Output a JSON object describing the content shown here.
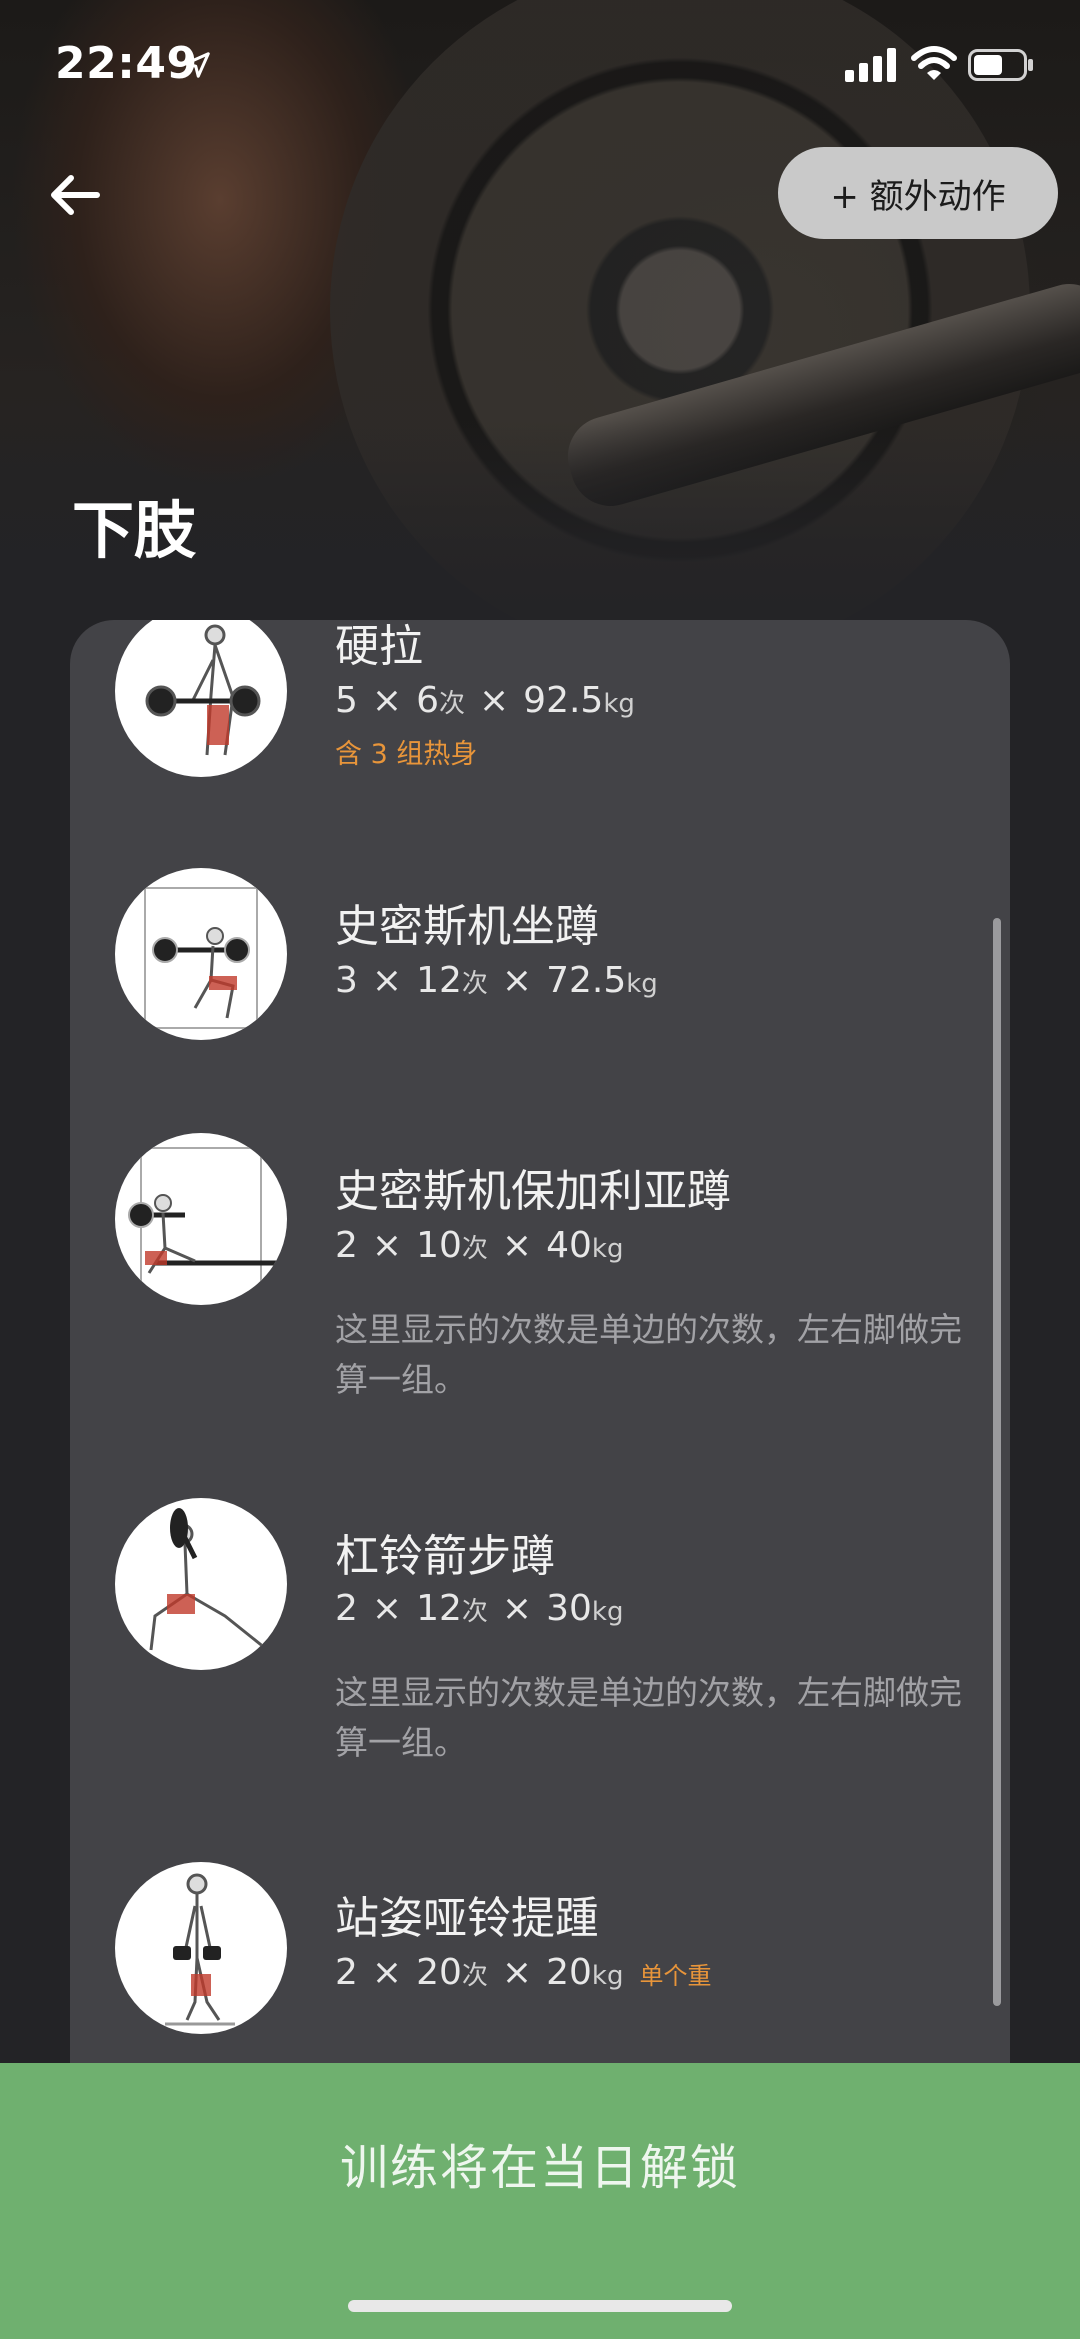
{
  "status_bar": {
    "time": "22:49"
  },
  "header": {
    "extra_button": "+ 额外动作",
    "title": "下肢"
  },
  "exercises": [
    {
      "name": "硬拉",
      "sets": "5",
      "reps": "6",
      "reps_unit": "次",
      "weight": "92.5",
      "weight_unit": "kg",
      "tag": "含 3 组热身"
    },
    {
      "name": "史密斯机坐蹲",
      "sets": "3",
      "reps": "12",
      "reps_unit": "次",
      "weight": "72.5",
      "weight_unit": "kg"
    },
    {
      "name": "史密斯机保加利亚蹲",
      "sets": "2",
      "reps": "10",
      "reps_unit": "次",
      "weight": "40",
      "weight_unit": "kg",
      "note": "这里显示的次数是单边的次数，左右脚做完算一组。"
    },
    {
      "name": "杠铃箭步蹲",
      "sets": "2",
      "reps": "12",
      "reps_unit": "次",
      "weight": "30",
      "weight_unit": "kg",
      "note": "这里显示的次数是单边的次数，左右脚做完算一组。"
    },
    {
      "name": "站姿哑铃提踵",
      "sets": "2",
      "reps": "20",
      "reps_unit": "次",
      "weight": "20",
      "weight_unit": "kg",
      "tag": "单个重"
    }
  ],
  "times_symbol": "×",
  "bottom": {
    "unlock_label": "训练将在当日解锁"
  },
  "colors": {
    "accent_green": "#6fb06f",
    "tag_orange": "#e8953a",
    "card_bg": "#434347"
  },
  "icons": [
    "location-arrow-icon",
    "cellular-signal-icon",
    "wifi-icon",
    "battery-icon",
    "back-arrow-icon"
  ]
}
